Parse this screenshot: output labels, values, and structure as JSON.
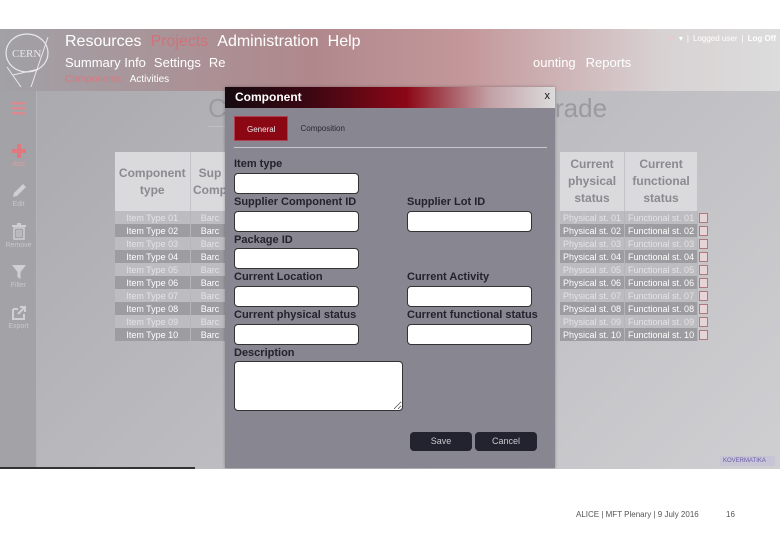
{
  "header": {
    "logo_text": "CERN",
    "nav_main": [
      {
        "label": "Resources",
        "active": false
      },
      {
        "label": "Projects",
        "active": true
      },
      {
        "label": "Administration",
        "active": false
      },
      {
        "label": "Help",
        "active": false
      }
    ],
    "nav_sub": [
      "Summary Info",
      "Settings",
      "Re"
    ],
    "nav_sub_right": [
      "ounting",
      "Reports"
    ],
    "nav_third": [
      {
        "label": "Components",
        "active": true
      },
      {
        "label": "Activities",
        "active": false
      }
    ],
    "user_bar": {
      "dropdown": "▾",
      "user_label": "Logged user",
      "logoff_label": "Log Off"
    }
  },
  "sidebar": {
    "items": [
      {
        "icon": "menu-icon",
        "label": ""
      },
      {
        "icon": "plus-icon",
        "label": "Add"
      },
      {
        "icon": "pencil-icon",
        "label": "Edit"
      },
      {
        "icon": "trash-icon",
        "label": "Remove"
      },
      {
        "icon": "filter-icon",
        "label": "Filter"
      },
      {
        "icon": "export-icon",
        "label": "Export"
      }
    ]
  },
  "page": {
    "title_left": "C",
    "title_right": "rade"
  },
  "table": {
    "left_columns": [
      "Component type",
      "Sup Comp"
    ],
    "right_columns": [
      "Current physical status",
      "Current functional status"
    ],
    "rows": [
      {
        "type": "Item Type 01",
        "supplier": "Barc",
        "physical": "Physical st. 01",
        "functional": "Functional st. 01"
      },
      {
        "type": "Item Type 02",
        "supplier": "Barc",
        "physical": "Physical st. 02",
        "functional": "Functional st. 02"
      },
      {
        "type": "Item Type 03",
        "supplier": "Barc",
        "physical": "Physical st. 03",
        "functional": "Functional st. 03"
      },
      {
        "type": "Item Type 04",
        "supplier": "Barc",
        "physical": "Physical st. 04",
        "functional": "Functional st. 04"
      },
      {
        "type": "Item Type 05",
        "supplier": "Barc",
        "physical": "Physical st. 05",
        "functional": "Functional st. 05"
      },
      {
        "type": "Item Type 06",
        "supplier": "Barc",
        "physical": "Physical st. 06",
        "functional": "Functional st. 06"
      },
      {
        "type": "Item Type 07",
        "supplier": "Barc",
        "physical": "Physical st. 07",
        "functional": "Functional st. 07"
      },
      {
        "type": "Item Type 08",
        "supplier": "Barc",
        "physical": "Physical st. 08",
        "functional": "Functional st. 08"
      },
      {
        "type": "Item Type 09",
        "supplier": "Barc",
        "physical": "Physical st. 09",
        "functional": "Functional st. 09"
      },
      {
        "type": "Item Type 10",
        "supplier": "Barc",
        "physical": "Physical st. 10",
        "functional": "Functional st. 10"
      }
    ]
  },
  "modal": {
    "title": "Component",
    "close": "x",
    "tabs": [
      {
        "label": "General",
        "active": true
      },
      {
        "label": "Composition",
        "active": false
      }
    ],
    "fields": {
      "item_type": {
        "label": "Item type",
        "value": ""
      },
      "supplier_component_id": {
        "label": "Supplier Component ID",
        "value": ""
      },
      "supplier_lot_id": {
        "label": "Supplier Lot ID",
        "value": ""
      },
      "package_id": {
        "label": "Package ID",
        "value": ""
      },
      "current_location": {
        "label": "Current Location",
        "value": ""
      },
      "current_activity": {
        "label": "Current Activity",
        "value": ""
      },
      "current_physical_status": {
        "label": "Current physical status",
        "value": ""
      },
      "current_functional_status": {
        "label": "Current functional status",
        "value": ""
      },
      "description": {
        "label": "Description",
        "value": ""
      }
    },
    "save_label": "Save",
    "cancel_label": "Cancel"
  },
  "footer": {
    "brand": "KOVERMATIKA",
    "slide_text": "ALICE | MFT Plenary | 9 July 2016",
    "slide_number": "16"
  }
}
